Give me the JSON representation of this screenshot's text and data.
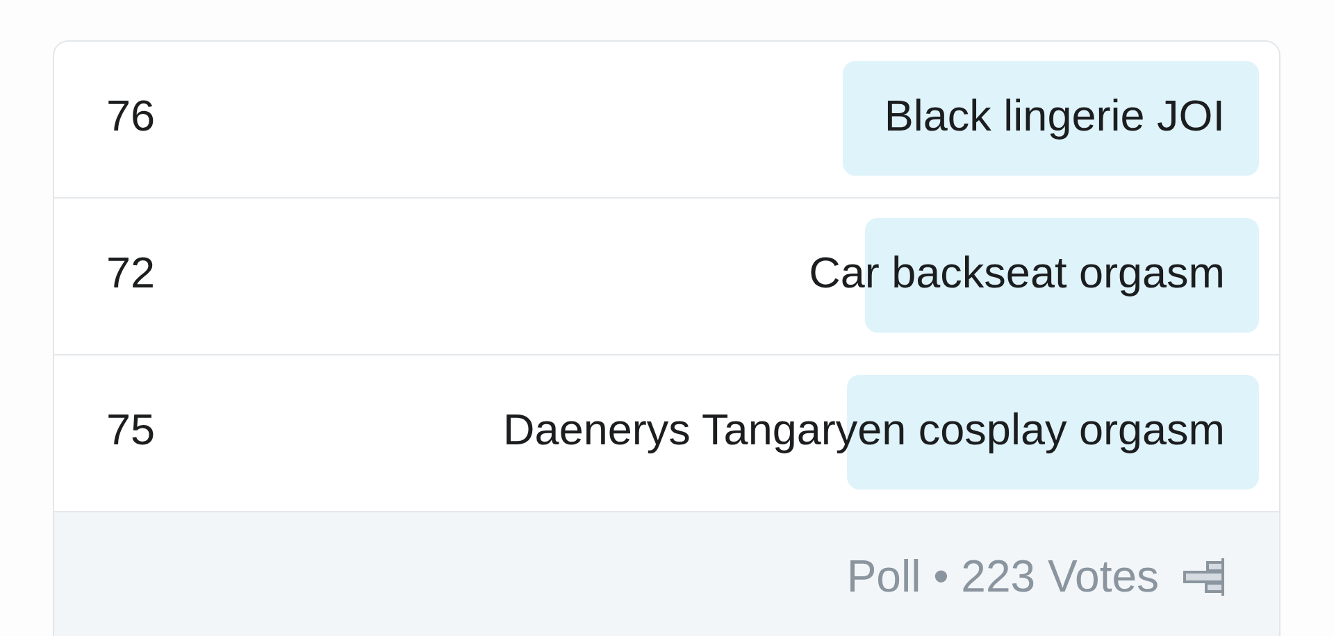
{
  "poll": {
    "options": [
      {
        "label": "Black lingerie JOI",
        "votes": "76",
        "level": 0.352
      },
      {
        "label": "Car backseat orgasm",
        "votes": "72",
        "level": 0.333
      },
      {
        "label": "Daenerys Tangaryen cosplay orgasm",
        "votes": "75",
        "level": 0.348
      }
    ],
    "footer": {
      "summary": "Poll • 223 Votes"
    }
  }
}
